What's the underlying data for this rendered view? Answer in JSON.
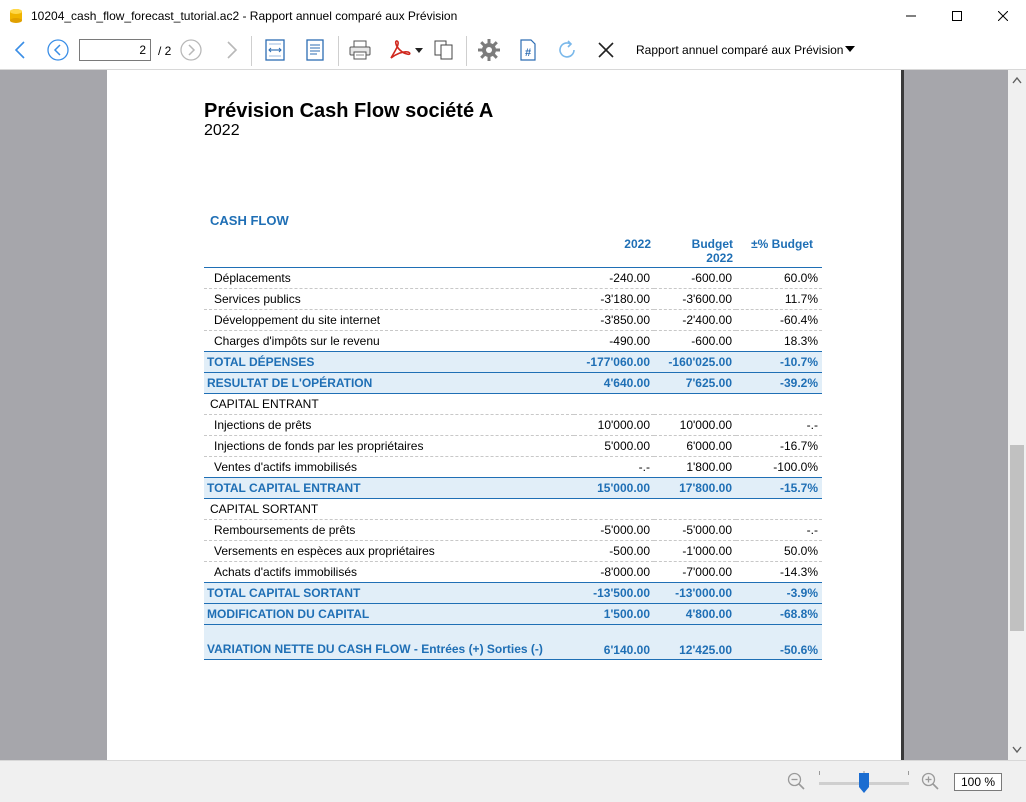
{
  "window": {
    "title": "10204_cash_flow_forecast_tutorial.ac2 - Rapport annuel comparé aux Prévision"
  },
  "toolbar": {
    "current_page": "2",
    "page_total": "/ 2",
    "report_name": "Rapport annuel comparé aux Prévision",
    "icons": [
      "back-arrow-icon",
      "prev-page-icon",
      "next-page-icon",
      "forward-arrow-icon",
      "fit-width-icon",
      "fit-page-icon",
      "print-icon",
      "pdf-icon",
      "copy-icon",
      "settings-icon",
      "page-number-icon",
      "refresh-icon",
      "close-icon"
    ]
  },
  "report": {
    "title": "Prévision Cash Flow société A",
    "year": "2022",
    "section": "CASH FLOW",
    "headers": {
      "col1": "2022",
      "col2_line1": "Budget",
      "col2_line2": "2022",
      "col3": "±% Budget"
    },
    "rows": [
      {
        "type": "line",
        "label": "Déplacements",
        "v1": "-240.00",
        "v2": "-600.00",
        "v3": "60.0%"
      },
      {
        "type": "line",
        "label": "Services publics",
        "v1": "-3'180.00",
        "v2": "-3'600.00",
        "v3": "11.7%"
      },
      {
        "type": "line",
        "label": "Développement du site internet",
        "v1": "-3'850.00",
        "v2": "-2'400.00",
        "v3": "-60.4%"
      },
      {
        "type": "line",
        "label": "Charges d'impôts sur le revenu",
        "v1": "-490.00",
        "v2": "-600.00",
        "v3": "18.3%"
      },
      {
        "type": "total",
        "label": "TOTAL DÉPENSES",
        "v1": "-177'060.00",
        "v2": "-160'025.00",
        "v3": "-10.7%"
      },
      {
        "type": "total",
        "label": "RESULTAT DE L'OPÉRATION",
        "v1": "4'640.00",
        "v2": "7'625.00",
        "v3": "-39.2%"
      },
      {
        "type": "grp",
        "label": "CAPITAL ENTRANT",
        "v1": "",
        "v2": "",
        "v3": ""
      },
      {
        "type": "line",
        "label": "Injections de prêts",
        "v1": "10'000.00",
        "v2": "10'000.00",
        "v3": "-.-"
      },
      {
        "type": "line",
        "label": "Injections de fonds par les propriétaires",
        "v1": "5'000.00",
        "v2": "6'000.00",
        "v3": "-16.7%"
      },
      {
        "type": "line",
        "label": "Ventes d'actifs immobilisés",
        "v1": "-.-",
        "v2": "1'800.00",
        "v3": "-100.0%"
      },
      {
        "type": "total",
        "label": "TOTAL CAPITAL ENTRANT",
        "v1": "15'000.00",
        "v2": "17'800.00",
        "v3": "-15.7%"
      },
      {
        "type": "grp",
        "label": "CAPITAL SORTANT",
        "v1": "",
        "v2": "",
        "v3": ""
      },
      {
        "type": "line",
        "label": "Remboursements de prêts",
        "v1": "-5'000.00",
        "v2": "-5'000.00",
        "v3": "-.-"
      },
      {
        "type": "line",
        "label": "Versements en espèces aux propriétaires",
        "v1": "-500.00",
        "v2": "-1'000.00",
        "v3": "50.0%"
      },
      {
        "type": "line",
        "label": "Achats d'actifs immobilisés",
        "v1": "-8'000.00",
        "v2": "-7'000.00",
        "v3": "-14.3%"
      },
      {
        "type": "total",
        "label": "TOTAL CAPITAL SORTANT",
        "v1": "-13'500.00",
        "v2": "-13'000.00",
        "v3": "-3.9%"
      },
      {
        "type": "total",
        "label": "MODIFICATION DU CAPITAL",
        "v1": "1'500.00",
        "v2": "4'800.00",
        "v3": "-68.8%"
      },
      {
        "type": "total tall",
        "label": "VARIATION NETTE DU CASH FLOW - Entrées (+) Sorties (-)",
        "v1": "6'140.00",
        "v2": "12'425.00",
        "v3": "-50.6%"
      }
    ]
  },
  "statusbar": {
    "zoom": "100 %",
    "zoom_level_percent": 100
  },
  "colors": {
    "accent": "#1f6fb5",
    "total_bg": "#e1eef8",
    "viewer_bg": "#a6a6ab"
  }
}
